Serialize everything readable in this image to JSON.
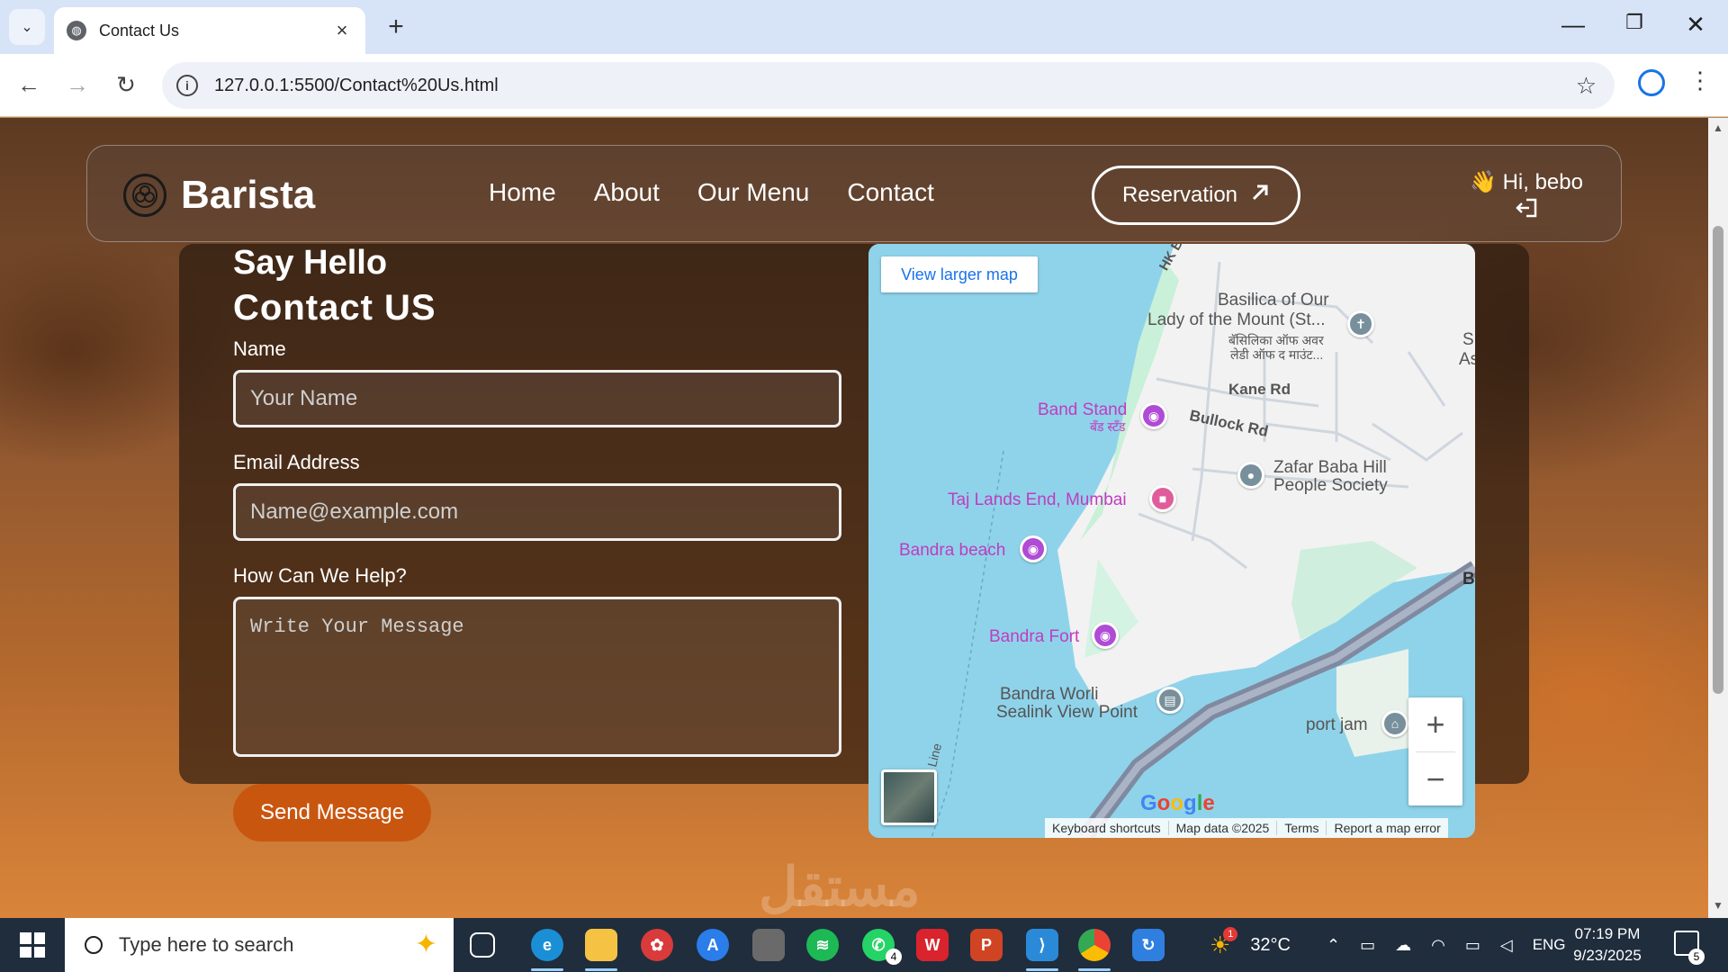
{
  "browser": {
    "tab_title": "Contact Us",
    "url": "127.0.0.1:5500/Contact%20Us.html"
  },
  "navbar": {
    "brand": "Barista",
    "links": [
      "Home",
      "About",
      "Our Menu",
      "Contact"
    ],
    "reservation_label": "Reservation",
    "greeting": "Hi, bebo",
    "greeting_emoji": "👋"
  },
  "form": {
    "say_hello": "Say Hello",
    "heading": "Contact US",
    "name_label": "Name",
    "name_placeholder": "Your Name",
    "email_label": "Email Address",
    "email_placeholder": "Name@example.com",
    "help_label": "How Can We Help?",
    "message_placeholder": "Write Your Message",
    "send_label": "Send Message"
  },
  "map": {
    "view_larger": "View larger map",
    "labels": {
      "basilica_1": "Basilica of Our",
      "basilica_2": "Lady of the Mount (St...",
      "basilica_hi_1": "बॅसिलिका ऑफ अवर",
      "basilica_hi_2": "लेडी ऑफ द माउंट...",
      "hk": "HK B",
      "kane_rd": "Kane Rd",
      "band_stand": "Band Stand",
      "band_stand_hi": "बँड स्टँड",
      "bullock_rd": "Bullock Rd",
      "zafar_1": "Zafar Baba Hill",
      "zafar_2": "People Society",
      "taj": "Taj Lands End, Mumbai",
      "bandra_beach": "Bandra beach",
      "bandra_fort": "Bandra Fort",
      "sealink_1": "Bandra Worli",
      "sealink_2": "Sealink View Point",
      "port_jam": "port jam",
      "line": "Line",
      "edge_s": "S",
      "edge_as": "As",
      "edge_b": "B"
    },
    "google": "Google",
    "attribution": [
      "Keyboard shortcuts",
      "Map data ©2025",
      "Terms",
      "Report a map error"
    ],
    "zoom_in": "+",
    "zoom_out": "−"
  },
  "watermark": "مستقل",
  "taskbar": {
    "search_placeholder": "Type here to search",
    "weather": "32°C",
    "weather_badge": "1",
    "whatsapp_badge": "4",
    "language": "ENG",
    "time": "07:19 PM",
    "date": "9/23/2025",
    "notifications": "5"
  }
}
